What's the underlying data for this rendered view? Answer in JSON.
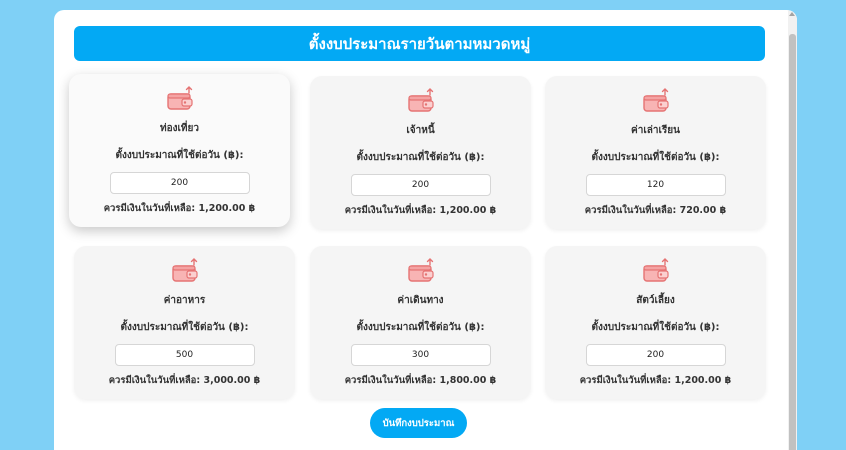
{
  "header": {
    "title": "ตั้งงบประมาณรายวันตามหมวดหมู่"
  },
  "common": {
    "budget_label": "ตั้งงบประมาณที่ใช้ต่อวัน (฿):",
    "wallet_icon": "wallet-icon",
    "wallet_color": "#e57373"
  },
  "categories": [
    {
      "name": "ท่องเที่ยว",
      "budget": "200",
      "remaining": "ควรมีเงินในวันที่เหลือ: 1,200.00 ฿"
    },
    {
      "name": "เจ้าหนี้",
      "budget": "200",
      "remaining": "ควรมีเงินในวันที่เหลือ: 1,200.00 ฿"
    },
    {
      "name": "ค่าเล่าเรียน",
      "budget": "120",
      "remaining": "ควรมีเงินในวันที่เหลือ: 720.00 ฿"
    },
    {
      "name": "ค่าอาหาร",
      "budget": "500",
      "remaining": "ควรมีเงินในวันที่เหลือ: 3,000.00 ฿"
    },
    {
      "name": "ค่าเดินทาง",
      "budget": "300",
      "remaining": "ควรมีเงินในวันที่เหลือ: 1,800.00 ฿"
    },
    {
      "name": "สัตว์เลี้ยง",
      "budget": "200",
      "remaining": "ควรมีเงินในวันที่เหลือ: 1,200.00 ฿"
    }
  ],
  "actions": {
    "save_label": "บันทึกงบประมาณ"
  },
  "colors": {
    "accent": "#03a9f4",
    "page_background": "#7fd0f6"
  }
}
